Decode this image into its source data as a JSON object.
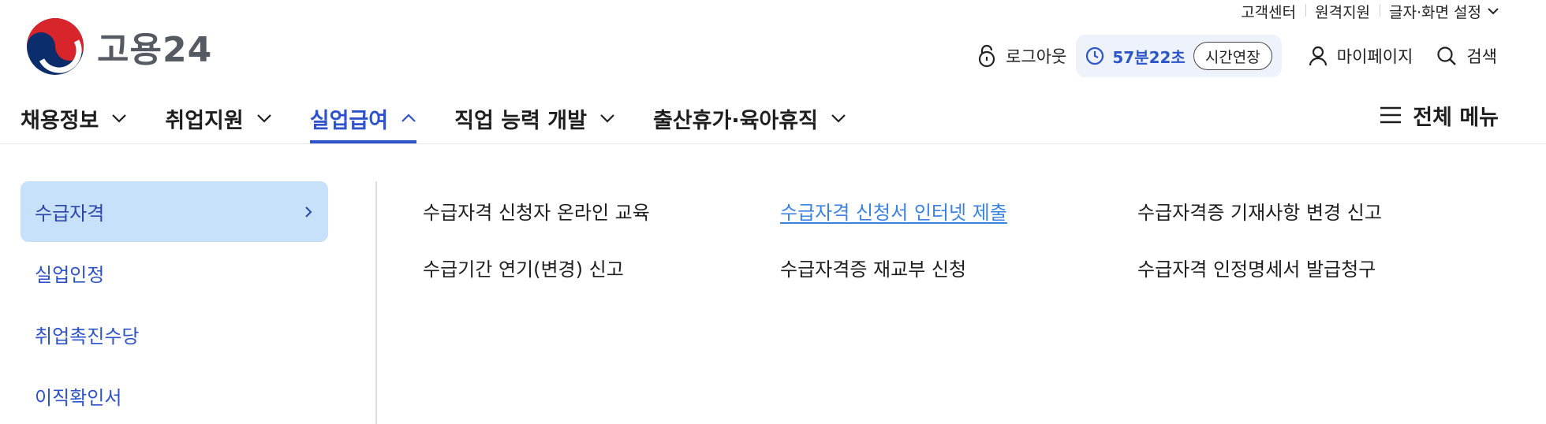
{
  "util_bar": {
    "items": [
      "고객센터",
      "원격지원",
      "글자·화면 설정"
    ]
  },
  "logo": {
    "text": "고용24"
  },
  "header": {
    "logout": "로그아웃",
    "timer": "57분22초",
    "extend": "시간연장",
    "mypage": "마이페이지",
    "search": "검색"
  },
  "gnb": {
    "items": [
      "채용정보",
      "취업지원",
      "실업급여",
      "직업 능력 개발",
      "출산휴가·육아휴직"
    ],
    "active_index": 2,
    "all_menu": "전체 메뉴"
  },
  "submenu": {
    "side": [
      "수급자격",
      "실업인정",
      "취업촉진수당",
      "이직확인서"
    ],
    "side_active_index": 0,
    "links": [
      [
        "수급자격 신청자 온라인 교육",
        "수급자격 신청서 인터넷 제출",
        "수급자격증 기재사항 변경 신고"
      ],
      [
        "수급기간 연기(변경) 신고",
        "수급자격증 재교부 신청",
        "수급자격 인정명세서 발급청구"
      ]
    ],
    "highlighted_link": "수급자격 신청서 인터넷 제출"
  },
  "colors": {
    "accent": "#2e52c9",
    "link_hover": "#3b82e0",
    "side_active_bg": "#c7e1fb",
    "timer_bg": "#eef2fb"
  }
}
